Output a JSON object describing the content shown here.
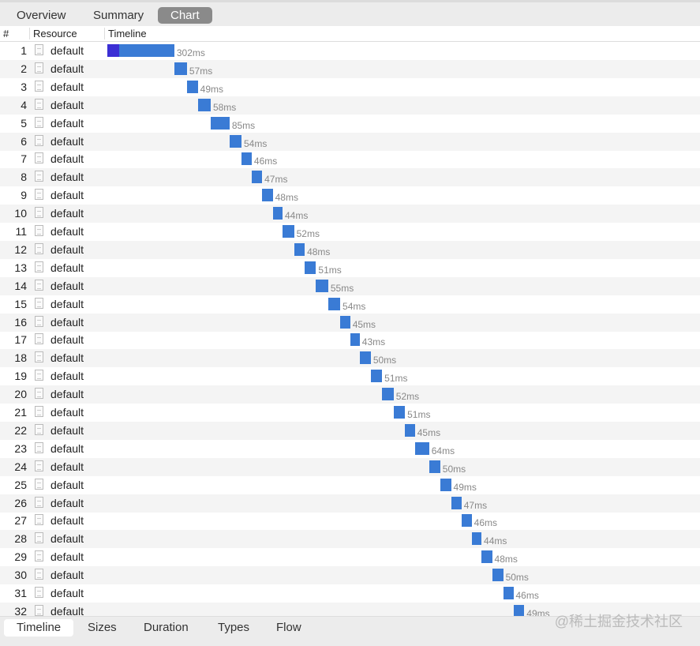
{
  "top_tabs": [
    {
      "label": "Overview",
      "active": false
    },
    {
      "label": "Summary",
      "active": false
    },
    {
      "label": "Chart",
      "active": true
    }
  ],
  "columns": {
    "num": "#",
    "resource": "Resource",
    "timeline": "Timeline"
  },
  "rows": [
    {
      "n": "1",
      "name": "default",
      "ms": 302,
      "label": "302ms"
    },
    {
      "n": "2",
      "name": "default",
      "ms": 57,
      "label": "57ms"
    },
    {
      "n": "3",
      "name": "default",
      "ms": 49,
      "label": "49ms"
    },
    {
      "n": "4",
      "name": "default",
      "ms": 58,
      "label": "58ms"
    },
    {
      "n": "5",
      "name": "default",
      "ms": 85,
      "label": "85ms"
    },
    {
      "n": "6",
      "name": "default",
      "ms": 54,
      "label": "54ms"
    },
    {
      "n": "7",
      "name": "default",
      "ms": 46,
      "label": "46ms"
    },
    {
      "n": "8",
      "name": "default",
      "ms": 47,
      "label": "47ms"
    },
    {
      "n": "9",
      "name": "default",
      "ms": 48,
      "label": "48ms"
    },
    {
      "n": "10",
      "name": "default",
      "ms": 44,
      "label": "44ms"
    },
    {
      "n": "11",
      "name": "default",
      "ms": 52,
      "label": "52ms"
    },
    {
      "n": "12",
      "name": "default",
      "ms": 48,
      "label": "48ms"
    },
    {
      "n": "13",
      "name": "default",
      "ms": 51,
      "label": "51ms"
    },
    {
      "n": "14",
      "name": "default",
      "ms": 55,
      "label": "55ms"
    },
    {
      "n": "15",
      "name": "default",
      "ms": 54,
      "label": "54ms"
    },
    {
      "n": "16",
      "name": "default",
      "ms": 45,
      "label": "45ms"
    },
    {
      "n": "17",
      "name": "default",
      "ms": 43,
      "label": "43ms"
    },
    {
      "n": "18",
      "name": "default",
      "ms": 50,
      "label": "50ms"
    },
    {
      "n": "19",
      "name": "default",
      "ms": 51,
      "label": "51ms"
    },
    {
      "n": "20",
      "name": "default",
      "ms": 52,
      "label": "52ms"
    },
    {
      "n": "21",
      "name": "default",
      "ms": 51,
      "label": "51ms"
    },
    {
      "n": "22",
      "name": "default",
      "ms": 45,
      "label": "45ms"
    },
    {
      "n": "23",
      "name": "default",
      "ms": 64,
      "label": "64ms"
    },
    {
      "n": "24",
      "name": "default",
      "ms": 50,
      "label": "50ms"
    },
    {
      "n": "25",
      "name": "default",
      "ms": 49,
      "label": "49ms"
    },
    {
      "n": "26",
      "name": "default",
      "ms": 47,
      "label": "47ms"
    },
    {
      "n": "27",
      "name": "default",
      "ms": 46,
      "label": "46ms"
    },
    {
      "n": "28",
      "name": "default",
      "ms": 44,
      "label": "44ms"
    },
    {
      "n": "29",
      "name": "default",
      "ms": 48,
      "label": "48ms"
    },
    {
      "n": "30",
      "name": "default",
      "ms": 50,
      "label": "50ms"
    },
    {
      "n": "31",
      "name": "default",
      "ms": 46,
      "label": "46ms"
    },
    {
      "n": "32",
      "name": "default",
      "ms": 49,
      "label": "49ms"
    }
  ],
  "colors": {
    "bar": "#3a7bd5",
    "bar_wait": "#3b2fd4"
  },
  "bottom_tabs": [
    {
      "label": "Timeline",
      "active": true
    },
    {
      "label": "Sizes",
      "active": false
    },
    {
      "label": "Duration",
      "active": false
    },
    {
      "label": "Types",
      "active": false
    },
    {
      "label": "Flow",
      "active": false
    }
  ],
  "watermark": "@稀土掘金技术社区"
}
